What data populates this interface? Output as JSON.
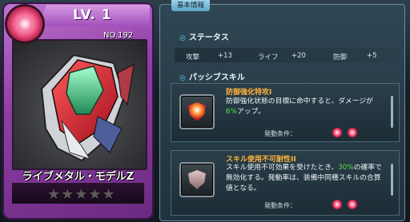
{
  "card": {
    "level": "LV.  1",
    "number": "NO.192",
    "name": "ライブメタル・モデルZ",
    "rarity_stars_filled": 0,
    "rarity_stars_total": 5,
    "stars": "★★★★★"
  },
  "panel": {
    "tab_label": "基本情報",
    "status": {
      "title": "ステータス",
      "attack_label": "攻撃",
      "attack_value": "+13",
      "life_label": "ライフ",
      "life_value": "+20",
      "defense_label": "防御",
      "defense_value": "+5"
    },
    "passive": {
      "title": "パッシブスキル",
      "skills": [
        {
          "name": "防御強化特攻I",
          "desc_part1": "防御強化状態の目標に命中すると、ダメージが",
          "desc_highlight": "6%",
          "desc_part2": "アップ。",
          "condition_label": "発動条件："
        },
        {
          "name": "スキル使用不可耐性II",
          "desc_part1": "スキル使用不可効果を受けたとき、",
          "desc_highlight": "30%",
          "desc_part2": "の確率で無効化する。発動率は、装備中同種スキルの合算値となる。",
          "condition_label": "発動条件："
        }
      ]
    }
  },
  "colors": {
    "card_purple": "#a24fbb",
    "panel_bg": "#2f4654",
    "skill_name_orange": "#ffb43c",
    "highlight_green": "#58e04b"
  }
}
